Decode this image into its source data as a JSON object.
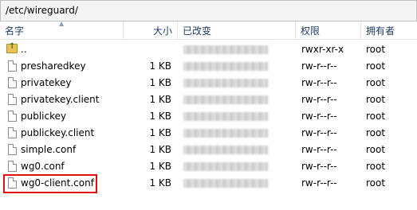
{
  "path": "/etc/wireguard/",
  "columns": {
    "name": "名字",
    "size": "大小",
    "modified": "已改变",
    "perms": "权限",
    "owner": "拥有者"
  },
  "files": [
    {
      "name": "..",
      "size": "",
      "perms": "rwxr-xr-x",
      "owner": "root",
      "icon": "parent-folder-icon"
    },
    {
      "name": "presharedkey",
      "size": "1 KB",
      "perms": "rw-r--r--",
      "owner": "root",
      "icon": "file-icon"
    },
    {
      "name": "privatekey",
      "size": "1 KB",
      "perms": "rw-r--r--",
      "owner": "root",
      "icon": "file-icon"
    },
    {
      "name": "privatekey.client",
      "size": "1 KB",
      "perms": "rw-r--r--",
      "owner": "root",
      "icon": "file-icon"
    },
    {
      "name": "publickey",
      "size": "1 KB",
      "perms": "rw-r--r--",
      "owner": "root",
      "icon": "file-icon"
    },
    {
      "name": "publickey.client",
      "size": "1 KB",
      "perms": "rw-r--r--",
      "owner": "root",
      "icon": "file-icon"
    },
    {
      "name": "simple.conf",
      "size": "1 KB",
      "perms": "rw-r--r--",
      "owner": "root",
      "icon": "file-icon"
    },
    {
      "name": "wg0.conf",
      "size": "1 KB",
      "perms": "rw-r--r--",
      "owner": "root",
      "icon": "file-icon"
    },
    {
      "name": "wg0-client.conf",
      "size": "1 KB",
      "perms": "rw-r--r--",
      "owner": "root",
      "icon": "file-icon"
    }
  ],
  "highlight_color": "#e01010"
}
